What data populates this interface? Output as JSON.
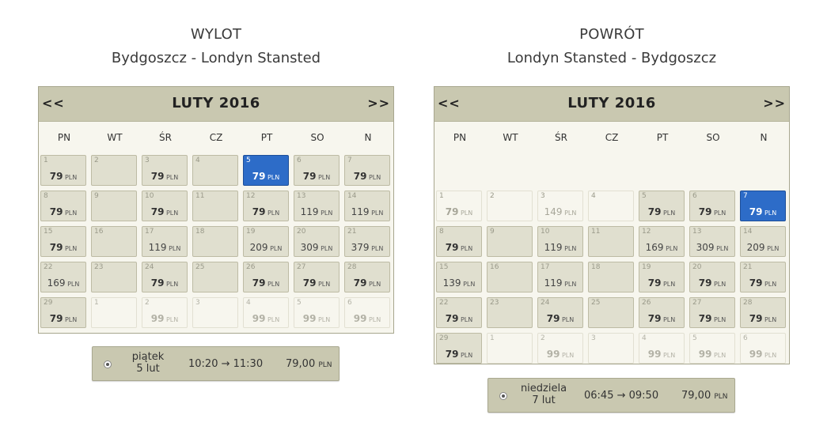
{
  "outbound": {
    "title": "WYLOT",
    "route": "Bydgoszcz - Londyn Stansted",
    "calendar": {
      "prev": "<<",
      "next": ">>",
      "month": "LUTY 2016",
      "weekdays": [
        "PN",
        "WT",
        "ŚR",
        "CZ",
        "PT",
        "SO",
        "N"
      ],
      "cells": [
        {
          "day": "1",
          "price": "79",
          "bold": true
        },
        {
          "day": "2",
          "price": ""
        },
        {
          "day": "3",
          "price": "79",
          "bold": true
        },
        {
          "day": "4",
          "price": ""
        },
        {
          "day": "5",
          "price": "79",
          "bold": true,
          "selected": true
        },
        {
          "day": "6",
          "price": "79",
          "bold": true
        },
        {
          "day": "7",
          "price": "79",
          "bold": true
        },
        {
          "day": "8",
          "price": "79",
          "bold": true
        },
        {
          "day": "9",
          "price": ""
        },
        {
          "day": "10",
          "price": "79",
          "bold": true
        },
        {
          "day": "11",
          "price": ""
        },
        {
          "day": "12",
          "price": "79",
          "bold": true
        },
        {
          "day": "13",
          "price": "119"
        },
        {
          "day": "14",
          "price": "119"
        },
        {
          "day": "15",
          "price": "79",
          "bold": true
        },
        {
          "day": "16",
          "price": ""
        },
        {
          "day": "17",
          "price": "119"
        },
        {
          "day": "18",
          "price": ""
        },
        {
          "day": "19",
          "price": "209"
        },
        {
          "day": "20",
          "price": "309"
        },
        {
          "day": "21",
          "price": "379"
        },
        {
          "day": "22",
          "price": "169"
        },
        {
          "day": "23",
          "price": ""
        },
        {
          "day": "24",
          "price": "79",
          "bold": true
        },
        {
          "day": "25",
          "price": ""
        },
        {
          "day": "26",
          "price": "79",
          "bold": true
        },
        {
          "day": "27",
          "price": "79",
          "bold": true
        },
        {
          "day": "28",
          "price": "79",
          "bold": true
        },
        {
          "day": "29",
          "price": "79",
          "bold": true
        },
        {
          "day": "1",
          "price": "",
          "other": true
        },
        {
          "day": "2",
          "price": "99",
          "bold": true,
          "other": true
        },
        {
          "day": "3",
          "price": "",
          "other": true
        },
        {
          "day": "4",
          "price": "99",
          "bold": true,
          "other": true
        },
        {
          "day": "5",
          "price": "99",
          "bold": true,
          "other": true
        },
        {
          "day": "6",
          "price": "99",
          "bold": true,
          "other": true
        }
      ],
      "currency": "PLN"
    },
    "flight": {
      "day_name": "piątek",
      "date": "5 lut",
      "times": "10:20 → 11:30",
      "price": "79,00",
      "currency": "PLN"
    }
  },
  "return": {
    "title": "POWRÓT",
    "route": "Londyn Stansted - Bydgoszcz",
    "calendar": {
      "prev": "<<",
      "next": ">>",
      "month": "LUTY 2016",
      "weekdays": [
        "PN",
        "WT",
        "ŚR",
        "CZ",
        "PT",
        "SO",
        "N"
      ],
      "cells": [
        {
          "day": "1",
          "price": "79",
          "bold": true,
          "dim": true
        },
        {
          "day": "2",
          "price": "",
          "dim": true
        },
        {
          "day": "3",
          "price": "149",
          "dim": true
        },
        {
          "day": "4",
          "price": "",
          "dim": true
        },
        {
          "day": "5",
          "price": "79",
          "bold": true
        },
        {
          "day": "6",
          "price": "79",
          "bold": true
        },
        {
          "day": "7",
          "price": "79",
          "bold": true,
          "selected": true
        },
        {
          "day": "8",
          "price": "79",
          "bold": true
        },
        {
          "day": "9",
          "price": ""
        },
        {
          "day": "10",
          "price": "119"
        },
        {
          "day": "11",
          "price": ""
        },
        {
          "day": "12",
          "price": "169"
        },
        {
          "day": "13",
          "price": "309"
        },
        {
          "day": "14",
          "price": "209"
        },
        {
          "day": "15",
          "price": "139"
        },
        {
          "day": "16",
          "price": ""
        },
        {
          "day": "17",
          "price": "119"
        },
        {
          "day": "18",
          "price": ""
        },
        {
          "day": "19",
          "price": "79",
          "bold": true
        },
        {
          "day": "20",
          "price": "79",
          "bold": true
        },
        {
          "day": "21",
          "price": "79",
          "bold": true
        },
        {
          "day": "22",
          "price": "79",
          "bold": true
        },
        {
          "day": "23",
          "price": ""
        },
        {
          "day": "24",
          "price": "79",
          "bold": true
        },
        {
          "day": "25",
          "price": ""
        },
        {
          "day": "26",
          "price": "79",
          "bold": true
        },
        {
          "day": "27",
          "price": "79",
          "bold": true
        },
        {
          "day": "28",
          "price": "79",
          "bold": true
        },
        {
          "day": "29",
          "price": "79",
          "bold": true
        },
        {
          "day": "1",
          "price": "",
          "other": true
        },
        {
          "day": "2",
          "price": "99",
          "bold": true,
          "other": true
        },
        {
          "day": "3",
          "price": "",
          "other": true
        },
        {
          "day": "4",
          "price": "99",
          "bold": true,
          "other": true
        },
        {
          "day": "5",
          "price": "99",
          "bold": true,
          "other": true
        },
        {
          "day": "6",
          "price": "99",
          "bold": true,
          "other": true
        }
      ],
      "currency": "PLN"
    },
    "flight": {
      "day_name": "niedziela",
      "date": "7 lut",
      "times": "06:45 → 09:50",
      "price": "79,00",
      "currency": "PLN"
    }
  },
  "colors": {
    "header_bg": "#c9c8b0",
    "cell_bg": "#e0dfcf",
    "selected": "#2d6cc8"
  }
}
